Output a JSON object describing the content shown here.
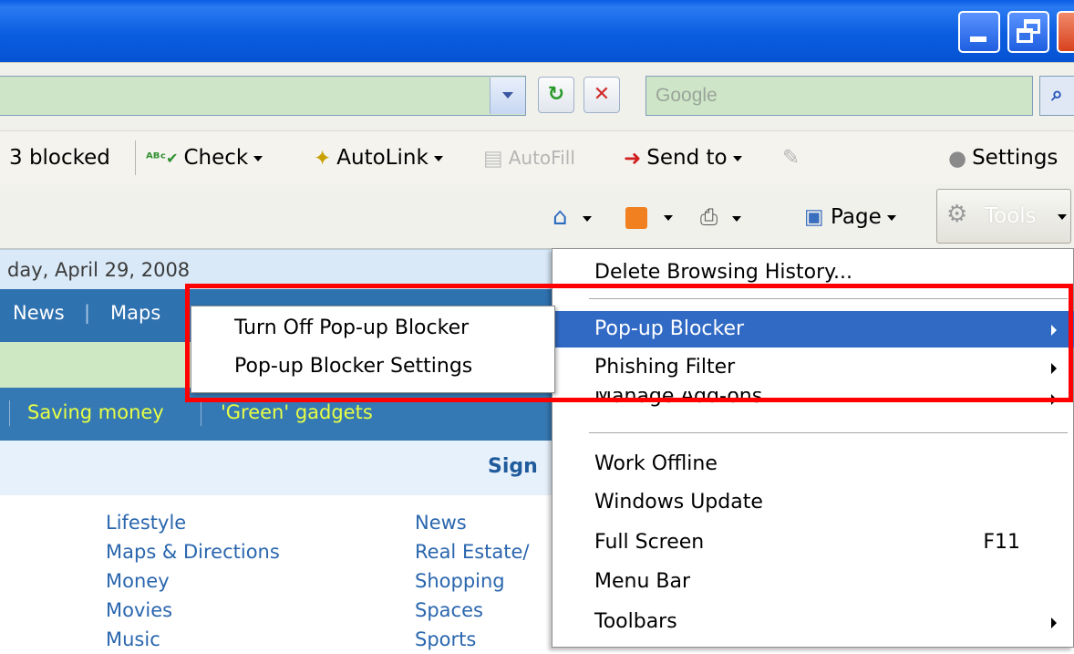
{
  "titlebar": {
    "buttons": [
      "minimize",
      "restore"
    ]
  },
  "address": {
    "search_placeholder": "Google"
  },
  "google_toolbar": {
    "blocked": "3 blocked",
    "check": "Check",
    "autolink": "AutoLink",
    "autofill": "AutoFill",
    "send_to": "Send to",
    "settings": "Settings"
  },
  "command_bar": {
    "page": "Page",
    "tools": "Tools"
  },
  "page": {
    "date": "day, April 29, 2008",
    "nav": [
      "News",
      "Maps"
    ],
    "topics": [
      "Saving money",
      "'Green' gadgets"
    ],
    "sign": "Sign",
    "links_col1": [
      "Lifestyle",
      "Maps & Directions",
      "Money",
      "Movies",
      "Music"
    ],
    "links_col2": [
      "News",
      "Real Estate/",
      "Shopping",
      "Spaces",
      "Sports"
    ]
  },
  "tools_menu": {
    "items": [
      {
        "label": "Delete Browsing History..."
      },
      {
        "label": "Pop-up Blocker"
      },
      {
        "label": "Phishing Filter"
      },
      {
        "label": "Manage Add-ons"
      },
      {
        "label": "Work Offline"
      },
      {
        "label": "Windows Update"
      },
      {
        "label": "Full Screen",
        "accel": "F11"
      },
      {
        "label": "Menu Bar"
      },
      {
        "label": "Toolbars"
      }
    ]
  },
  "popup_submenu": {
    "items": [
      "Turn Off Pop-up Blocker",
      "Pop-up Blocker Settings"
    ]
  },
  "colors": {
    "menu_highlight": "#316ac5",
    "annotation": "#ff0000",
    "title_bar": "#0b5de0"
  }
}
